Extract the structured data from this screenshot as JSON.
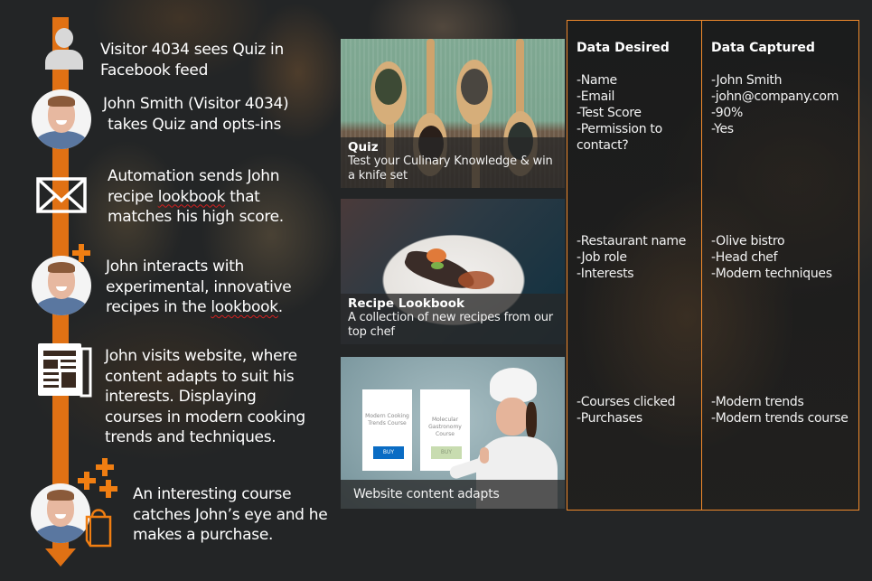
{
  "colors": {
    "accent": "#e07114",
    "table_border": "#f08a2c",
    "background": "#232526",
    "buy_primary": "#0a6cc4",
    "buy_secondary": "#c8dcb0"
  },
  "timeline": {
    "steps": [
      {
        "icon": "user-icon",
        "text": "Visitor 4034 sees Quiz in Facebook feed",
        "lines": [
          "Visitor 4034 sees Quiz in",
          "Facebook feed"
        ]
      },
      {
        "icon": "avatar",
        "lines": [
          "John Smith (Visitor 4034)",
          " takes Quiz and opts-ins"
        ]
      },
      {
        "icon": "envelope-icon",
        "lines": [
          "Automation sends John",
          "recipe ",
          "lookbook",
          " that",
          "matches his high score."
        ]
      },
      {
        "icon": "avatar-plus",
        "lines": [
          "John interacts with",
          "experimental, innovative",
          "recipes in the ",
          "lookbook",
          "."
        ]
      },
      {
        "icon": "newspaper-icon",
        "lines": [
          "John visits website, where",
          "content adapts to suit his",
          "interests. Displaying",
          "courses in modern cooking",
          "trends and techniques."
        ]
      },
      {
        "icon": "avatar-bag",
        "lines": [
          "An interesting course",
          "catches John’s eye and he",
          "makes a purchase."
        ]
      }
    ]
  },
  "cards": [
    {
      "title": "Quiz",
      "subtitle": "Test your Culinary Knowledge & win a knife set"
    },
    {
      "title": "Recipe Lookbook",
      "subtitle": "A collection of new recipes from our top chef"
    },
    {
      "title": "Website content adapts",
      "courses": [
        {
          "title": "Modern Cooking Trends Course",
          "buy": "BUY"
        },
        {
          "title": "Molecular Gastronomy Course",
          "buy": "BUY"
        }
      ]
    }
  ],
  "data_table": {
    "headers": {
      "desired": "Data Desired",
      "captured": "Data Captured"
    },
    "groups": [
      {
        "desired": [
          "-Name",
          "-Email",
          "-Test Score",
          "-Permission to",
          "contact?"
        ],
        "captured": [
          "-John Smith",
          "-john@company.com",
          "-90%",
          "-Yes"
        ]
      },
      {
        "desired": [
          "-Restaurant name",
          "-Job role",
          "-Interests"
        ],
        "captured": [
          "-Olive bistro",
          "-Head chef",
          "-Modern techniques"
        ]
      },
      {
        "desired": [
          "-Courses clicked",
          "-Purchases"
        ],
        "captured": [
          "-Modern trends",
          "-Modern trends course"
        ]
      }
    ]
  }
}
